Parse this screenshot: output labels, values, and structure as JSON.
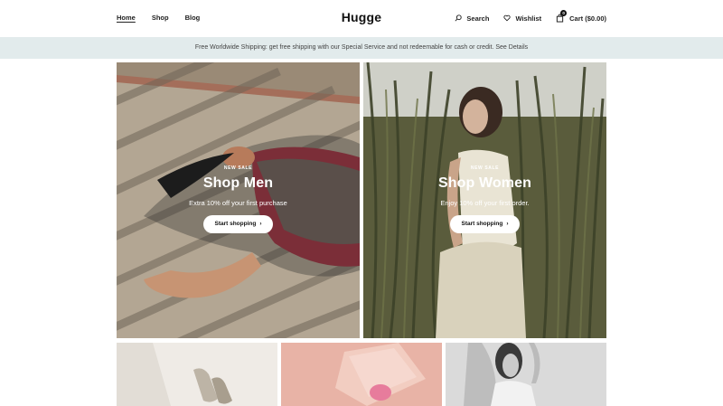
{
  "brand": {
    "logo": "Hugge"
  },
  "nav": {
    "items": [
      "Home",
      "Shop",
      "Blog"
    ]
  },
  "tools": {
    "search": "Search",
    "wishlist": "Wishlist",
    "cart": "Cart ($0.00)",
    "cart_count": "0"
  },
  "announcement": "Free Worldwide Shipping: get free shipping with our Special Service and not redeemable for cash or credit. See Details",
  "hero": [
    {
      "eyebrow": "NEW SALE",
      "title": "Shop Men",
      "subtitle": "Extra 10% off your first purchase",
      "button": "Start shopping"
    },
    {
      "eyebrow": "NEW SALE",
      "title": "Shop Women",
      "subtitle": "Enjoy 10% off your first order.",
      "button": "Start shopping"
    }
  ],
  "colors": {
    "announce_bg": "#e2ebec",
    "text": "#222222",
    "button_bg": "#ffffff"
  }
}
